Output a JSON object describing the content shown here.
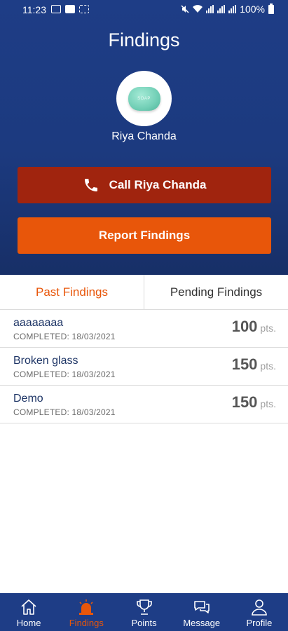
{
  "status_bar": {
    "time": "11:23",
    "battery": "100%"
  },
  "header": {
    "title": "Findings",
    "user_name": "Riya Chanda",
    "avatar_text": "SOAP",
    "call_button": "Call Riya Chanda",
    "report_button": "Report Findings"
  },
  "tabs": [
    {
      "label": "Past Findings",
      "active": true
    },
    {
      "label": "Pending Findings",
      "active": false
    }
  ],
  "findings": [
    {
      "title": "aaaaaaaa",
      "status": "COMPLETED: 18/03/2021",
      "points": "100",
      "unit": "pts."
    },
    {
      "title": "Broken glass",
      "status": "COMPLETED: 18/03/2021",
      "points": "150",
      "unit": "pts."
    },
    {
      "title": "Demo",
      "status": "COMPLETED: 18/03/2021",
      "points": "150",
      "unit": "pts."
    }
  ],
  "bottom_nav": [
    {
      "label": "Home",
      "icon": "home-icon",
      "active": false
    },
    {
      "label": "Findings",
      "icon": "siren-icon",
      "active": true
    },
    {
      "label": "Points",
      "icon": "trophy-icon",
      "active": false
    },
    {
      "label": "Message",
      "icon": "chat-icon",
      "active": false
    },
    {
      "label": "Profile",
      "icon": "user-icon",
      "active": false
    }
  ],
  "colors": {
    "header_blue": "#1e3d86",
    "call_red": "#a0240e",
    "accent_orange": "#e8560a",
    "finding_title": "#1e3566"
  }
}
